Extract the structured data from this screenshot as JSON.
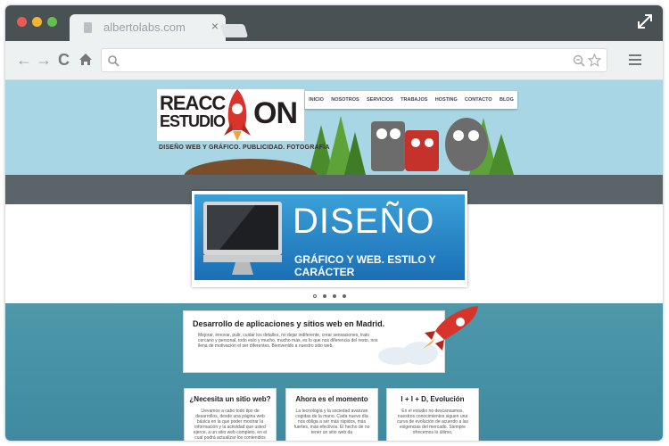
{
  "browser": {
    "tab_title": "albertolabs.com",
    "tab_close": "×",
    "nav_back": "←",
    "nav_forward": "→",
    "nav_reload": "C",
    "colors": {
      "close": "#ee5a52",
      "minimize": "#f5b433",
      "maximize": "#5fc24a"
    }
  },
  "site": {
    "logo_line1": "REACC",
    "logo_line2": "ESTUDIO",
    "logo_on": "ON",
    "tagline": "DISEÑO WEB Y GRÁFICO. PUBLICIDAD. FOTOGRAFÍA",
    "nav": [
      "INICIO",
      "NOSOTROS",
      "SERVICIOS",
      "TRABAJOS",
      "HOSTING",
      "CONTACTO",
      "BLOG"
    ],
    "banner_title": "DISEÑO",
    "banner_subtitle": "GRÁFICO Y WEB. ESTILO Y CARÁCTER",
    "intro_title": "Desarrollo de aplicaciones y sitios web en Madrid.",
    "intro_text": "Mejorar, innovar, pulir, cuidar los detalles, no dejar indiferente, crear sensaciones, trato cercano y personal, todo esto y mucho, mucho más, es lo que nos diferencia del resto, nos llena de motivación el ser diferentes. Bienvenido a nuestro sitio web.",
    "cards": [
      {
        "title": "¿Necesita un sitio web?",
        "text": "Llevamos a cabo todo tipo de desarrollos, desde una página web básica en la que poder mostrar la información y la actividad que usted ejerce, a un sitio web completo, en el cual podrá actualizar los contenidos sin"
      },
      {
        "title": "Ahora es el momento",
        "text": "La tecnología y la sociedad avanzan cogidas de la mano. Cada nuevo día nos obliga a ser más rápidos, más fuertes, más efectivos. El hecho de no tener un sitio web da"
      },
      {
        "title": "I + I + D, Evolución",
        "text": "En el estudio no descansamos, nuestros conocimientos siguen una curva de evolución de acuerdo a las exigencias del mercado. Siempre ofrecemos lo último,"
      }
    ]
  }
}
